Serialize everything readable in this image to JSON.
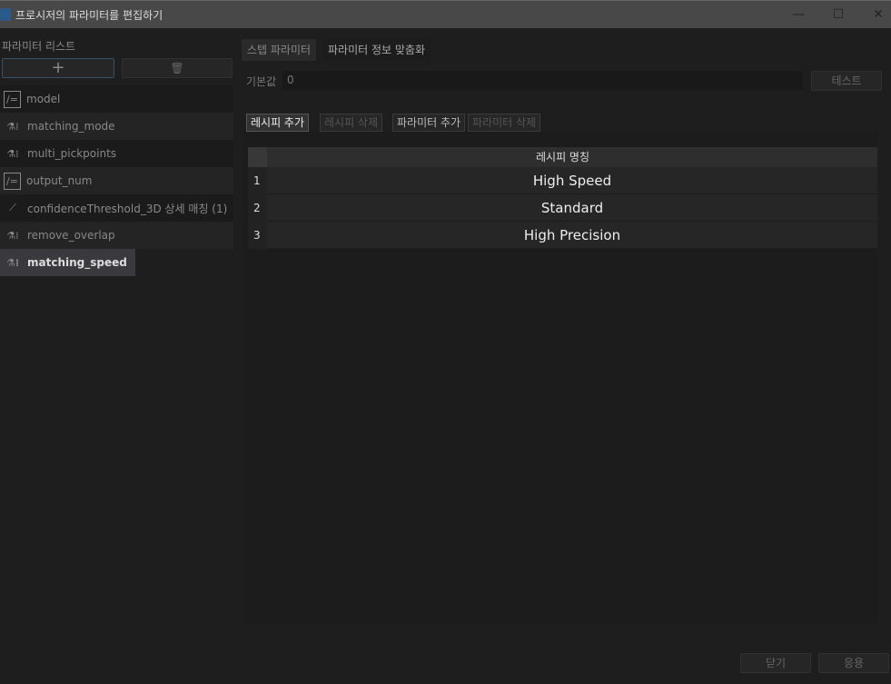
{
  "window": {
    "title": "프로시저의 파라미터를 편집하기"
  },
  "left": {
    "label": "파라미터 리스트",
    "add": "+",
    "params": [
      {
        "name": "model",
        "icon": "formula-icon"
      },
      {
        "name": "matching_mode",
        "icon": "flask-list-icon"
      },
      {
        "name": "multi_pickpoints",
        "icon": "flask-list-icon"
      },
      {
        "name": "output_num",
        "icon": "formula-icon"
      },
      {
        "name": "confidenceThreshold_3D 상세 매칭 (1)",
        "icon": "slider-icon"
      },
      {
        "name": "remove_overlap",
        "icon": "flask-list-icon"
      },
      {
        "name": "matching_speed",
        "icon": "flask-list-icon"
      }
    ]
  },
  "tabs": [
    "스텝 파라미터",
    "파라미터 정보 맞춤화"
  ],
  "default": {
    "label": "기본값",
    "value": "0",
    "test": "테스트"
  },
  "toolbar": [
    "레시피 추가",
    "레시피 삭제",
    "파라미터 추가",
    "파라미터 삭제"
  ],
  "table": {
    "header": "레시피 명칭",
    "rows": [
      {
        "n": "1",
        "name": "High Speed"
      },
      {
        "n": "2",
        "name": "Standard"
      },
      {
        "n": "3",
        "name": "High Precision"
      }
    ]
  },
  "footer": {
    "close": "닫기",
    "apply": "응용"
  }
}
